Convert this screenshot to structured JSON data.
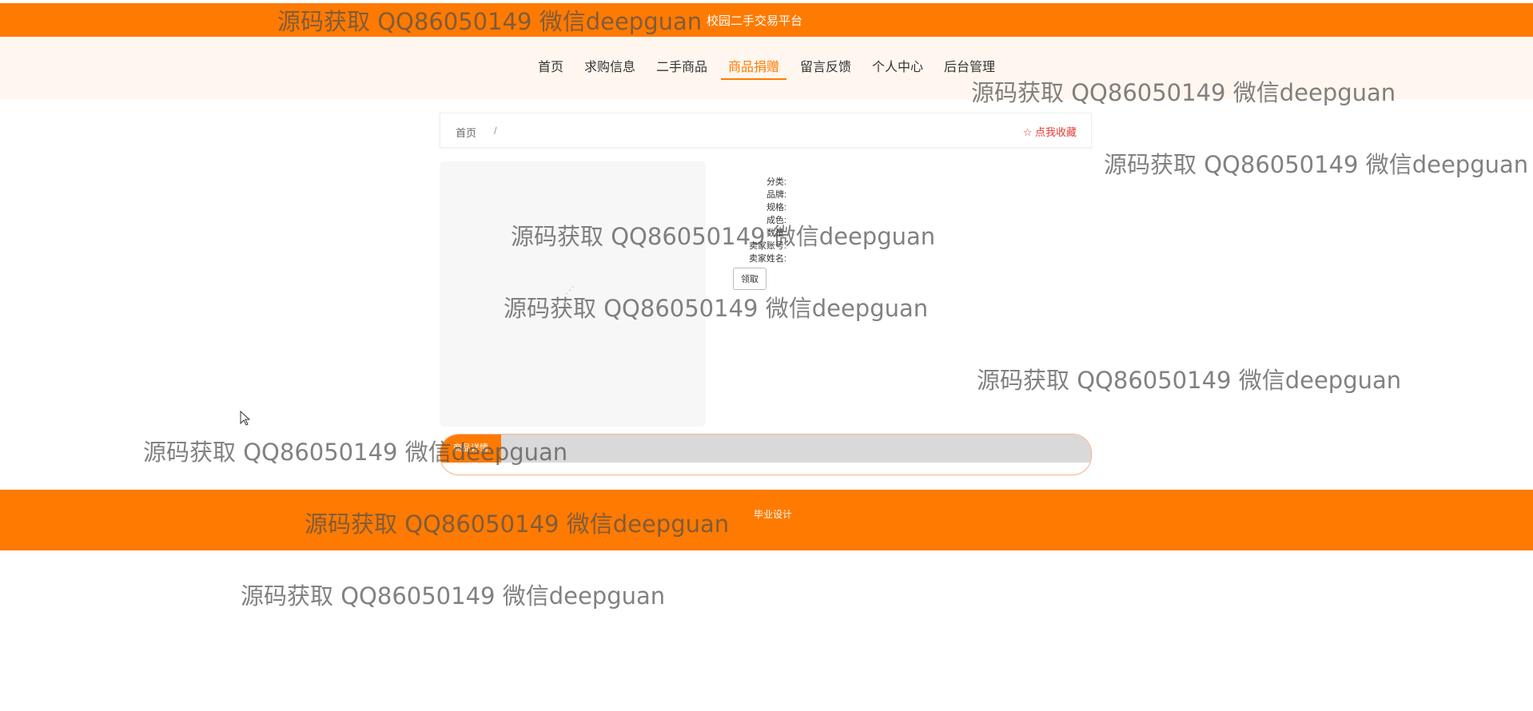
{
  "site": {
    "title": "校园二手交易平台"
  },
  "nav": {
    "items": [
      {
        "label": "首页"
      },
      {
        "label": "求购信息"
      },
      {
        "label": "二手商品"
      },
      {
        "label": "商品捐赠"
      },
      {
        "label": "留言反馈"
      },
      {
        "label": "个人中心"
      },
      {
        "label": "后台管理"
      }
    ],
    "active_index": 3
  },
  "breadcrumb": {
    "home": "首页",
    "separator": "/"
  },
  "collect": {
    "label": "☆ 点我收藏"
  },
  "details": {
    "rows": [
      {
        "label": "分类:"
      },
      {
        "label": "品牌:"
      },
      {
        "label": "规格:"
      },
      {
        "label": "成色:"
      },
      {
        "label": "数量:"
      },
      {
        "label": "卖家账号:"
      },
      {
        "label": "卖家姓名:"
      }
    ]
  },
  "claim_button": {
    "label": "领取"
  },
  "tabs": {
    "active_label": "商品详情"
  },
  "footer": {
    "text": "毕业设计"
  },
  "watermark": {
    "text": "源码获取 QQ86050149 微信deepguan"
  },
  "colors": {
    "accent": "#ff7a00",
    "nav_bg": "#fff6ef",
    "collect": "#e53935"
  }
}
